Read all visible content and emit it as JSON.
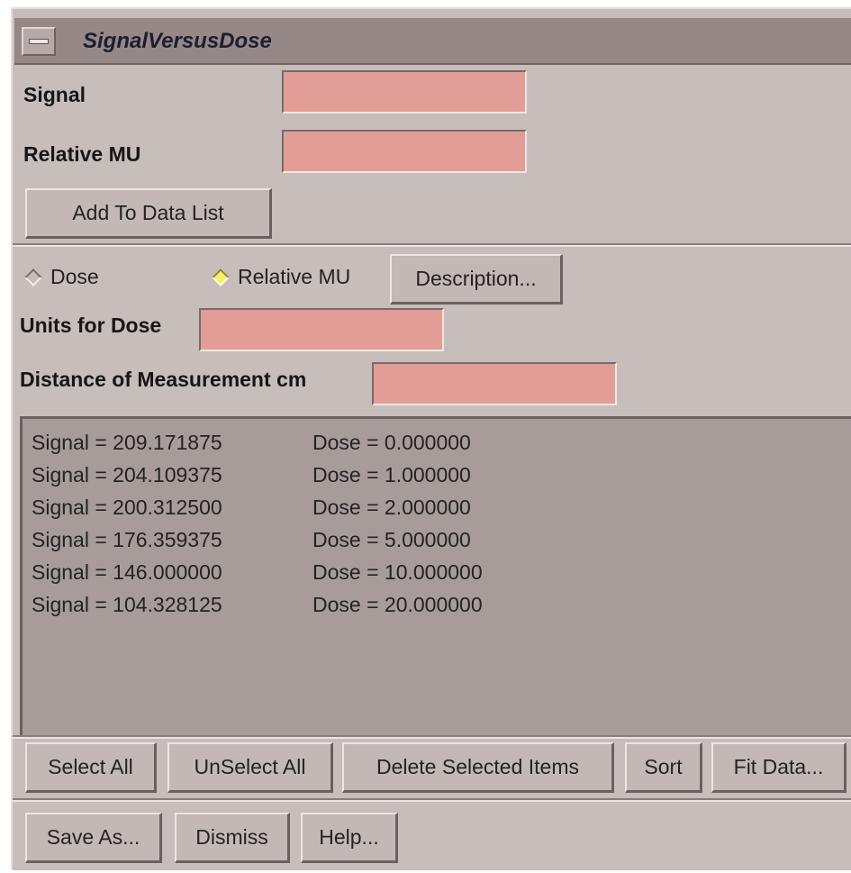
{
  "window": {
    "title": "SignalVersusDose"
  },
  "inputs": {
    "signal_label": "Signal",
    "signal_value": "",
    "relative_mu_label": "Relative MU",
    "relative_mu_value": "",
    "add_button": "Add To Data List"
  },
  "options": {
    "radio_dose": "Dose",
    "radio_relative_mu": "Relative MU",
    "selected": "Relative MU",
    "description_button": "Description...",
    "units_label": "Units for Dose",
    "units_value": "",
    "distance_label": "Distance of Measurement cm",
    "distance_value": ""
  },
  "data_list": [
    {
      "signal": "Signal = 209.171875",
      "dose": "Dose = 0.000000"
    },
    {
      "signal": "Signal = 204.109375",
      "dose": "Dose = 1.000000"
    },
    {
      "signal": "Signal = 200.312500",
      "dose": "Dose = 2.000000"
    },
    {
      "signal": "Signal = 176.359375",
      "dose": "Dose = 5.000000"
    },
    {
      "signal": "Signal = 146.000000",
      "dose": "Dose = 10.000000"
    },
    {
      "signal": "Signal = 104.328125",
      "dose": "Dose = 20.000000"
    }
  ],
  "list_actions": {
    "select_all": "Select All",
    "unselect_all": "UnSelect All",
    "delete_selected": "Delete Selected Items",
    "sort": "Sort",
    "fit_data": "Fit Data..."
  },
  "footer": {
    "save_as": "Save As...",
    "dismiss": "Dismiss",
    "help": "Help..."
  },
  "colors": {
    "window_bg": "#c7bdbb",
    "titlebar_bg": "#958887",
    "field_bg": "#e29e96",
    "list_bg": "#a89c9b",
    "radio_selected": "#f5ef6a"
  },
  "icons": {
    "window_menu": "window-menu-icon",
    "radio_unselected": "radio-diamond-off-icon",
    "radio_selected": "radio-diamond-on-icon"
  }
}
